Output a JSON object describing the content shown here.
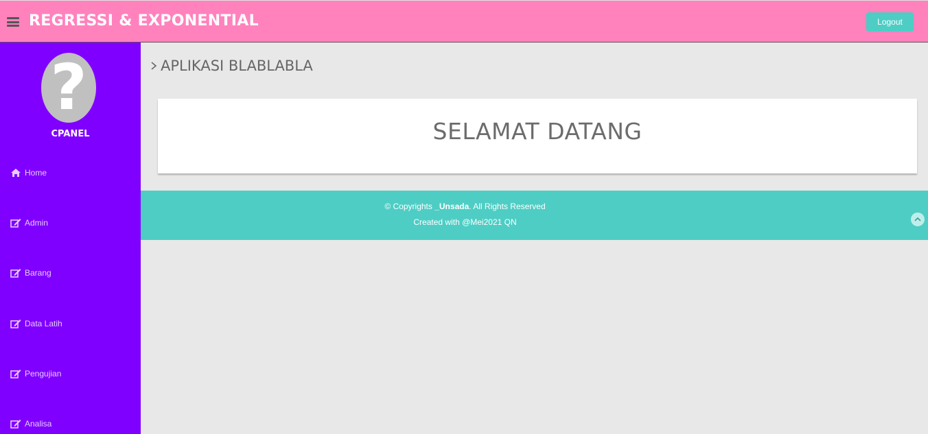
{
  "header": {
    "title": "REGRESSI & EXPONENTIAL",
    "logout_label": "Logout",
    "menu_icon": "hamburger-icon"
  },
  "sidebar": {
    "avatar_icon": "question-mark-avatar",
    "avatar_glyph": "?",
    "panel_label": "CPANEL",
    "items": [
      {
        "label": "Home",
        "icon": "home-icon"
      },
      {
        "label": "Admin",
        "icon": "edit-icon"
      },
      {
        "label": "Barang",
        "icon": "edit-icon"
      },
      {
        "label": "Data Latih",
        "icon": "edit-icon"
      },
      {
        "label": "Pengujian",
        "icon": "edit-icon"
      },
      {
        "label": "Analisa",
        "icon": "edit-icon"
      }
    ]
  },
  "main": {
    "heading": "APLIKASI BLABLABLA",
    "welcome": "SELAMAT DATANG"
  },
  "footer": {
    "copyright_prefix": "© Copyrights ",
    "copyright_brand": "_Unsada",
    "copyright_suffix": ". All Rights Reserved",
    "created": "Created with @Mei2021 QN",
    "go_top_icon": "chevron-up-icon"
  },
  "colors": {
    "header_bg": "#ff82bd",
    "sidebar_bg": "#8000ff",
    "accent": "#4ecdc4",
    "page_bg": "#e8e8e8"
  }
}
